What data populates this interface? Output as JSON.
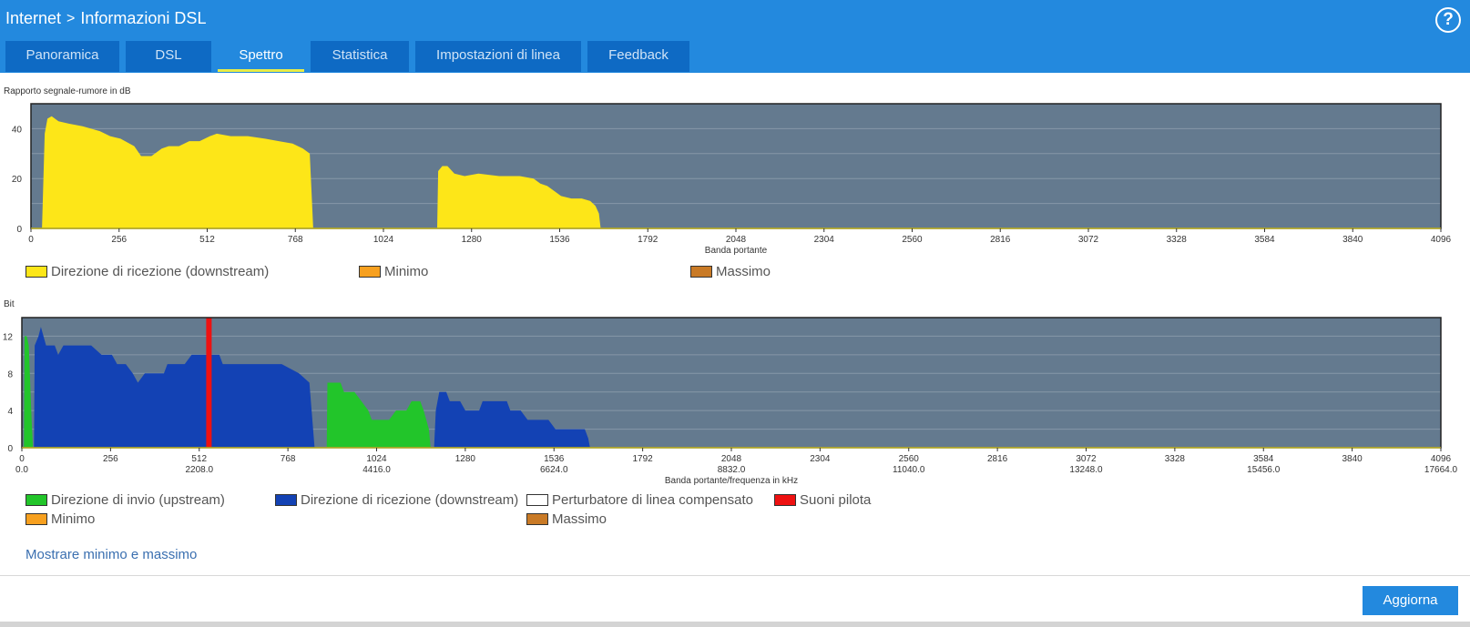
{
  "header": {
    "breadcrumb_root": "Internet",
    "breadcrumb_separator": ">",
    "breadcrumb_current": "Informazioni DSL",
    "help_label": "?"
  },
  "tabs": [
    {
      "label": "Panoramica",
      "active": false
    },
    {
      "label": "DSL",
      "active": false
    },
    {
      "label": "Spettro",
      "active": true
    },
    {
      "label": "Statistica",
      "active": false
    },
    {
      "label": "Impostazioni di linea",
      "active": false
    },
    {
      "label": "Feedback",
      "active": false
    }
  ],
  "colors": {
    "header_bg": "#2389de",
    "tab_bg": "#0e6ac4",
    "chart_bg": "#647a8f",
    "snr_downstream": "#fde618",
    "upstream": "#22c52a",
    "downstream": "#1342b4",
    "pilot": "#ee1111",
    "minimum": "#f7a01f",
    "maximum": "#c97a26"
  },
  "chart_data": [
    {
      "type": "area",
      "title": "Rapporto segnale-rumore in dB",
      "xlabel": "Banda portante",
      "xlim": [
        0,
        4096
      ],
      "ylim": [
        0,
        50
      ],
      "x_ticks": [
        0,
        256,
        512,
        768,
        1024,
        1280,
        1536,
        1792,
        2048,
        2304,
        2560,
        2816,
        3072,
        3328,
        3584,
        3840,
        4096
      ],
      "y_ticks": [
        0,
        20,
        40
      ],
      "grid": true,
      "legend": [
        {
          "label": "Direzione di ricezione (downstream)",
          "color": "#fde618"
        },
        {
          "label": "Minimo",
          "color": "#f7a01f"
        },
        {
          "label": "Massimo",
          "color": "#c97a26"
        }
      ],
      "series": [
        {
          "name": "Direzione di ricezione (downstream)",
          "color": "#fde618",
          "segments": [
            [
              [
                32,
                0
              ],
              [
                40,
                38
              ],
              [
                48,
                44
              ],
              [
                60,
                45
              ],
              [
                80,
                43
              ],
              [
                110,
                42
              ],
              [
                150,
                41
              ],
              [
                200,
                39
              ],
              [
                230,
                37
              ],
              [
                260,
                36
              ],
              [
                300,
                33
              ],
              [
                320,
                29
              ],
              [
                350,
                29
              ],
              [
                380,
                32
              ],
              [
                400,
                33
              ],
              [
                430,
                33
              ],
              [
                460,
                35
              ],
              [
                490,
                35
              ],
              [
                520,
                37
              ],
              [
                540,
                38
              ],
              [
                580,
                37
              ],
              [
                630,
                37
              ],
              [
                680,
                36
              ],
              [
                720,
                35
              ],
              [
                760,
                34
              ],
              [
                790,
                32
              ],
              [
                810,
                30
              ],
              [
                820,
                0
              ]
            ],
            [
              [
                1180,
                0
              ],
              [
                1183,
                23
              ],
              [
                1195,
                25
              ],
              [
                1210,
                25
              ],
              [
                1230,
                22
              ],
              [
                1260,
                21
              ],
              [
                1300,
                22
              ],
              [
                1360,
                21
              ],
              [
                1420,
                21
              ],
              [
                1460,
                20
              ],
              [
                1480,
                18
              ],
              [
                1500,
                17
              ],
              [
                1520,
                15
              ],
              [
                1540,
                13
              ],
              [
                1570,
                12
              ],
              [
                1600,
                12
              ],
              [
                1625,
                11
              ],
              [
                1640,
                9
              ],
              [
                1650,
                6
              ],
              [
                1655,
                0
              ]
            ]
          ]
        }
      ]
    },
    {
      "type": "area",
      "title": "Bit",
      "xlabel": "Banda portante/frequenza in kHz",
      "xlim": [
        0,
        4096
      ],
      "ylim": [
        0,
        14
      ],
      "x_ticks": [
        0,
        256,
        512,
        768,
        1024,
        1280,
        1536,
        1792,
        2048,
        2304,
        2560,
        2816,
        3072,
        3328,
        3584,
        3840,
        4096
      ],
      "x_freq_ticks": [
        {
          "at": 0,
          "label": "0.0"
        },
        {
          "at": 512,
          "label": "2208.0"
        },
        {
          "at": 1024,
          "label": "4416.0"
        },
        {
          "at": 1536,
          "label": "6624.0"
        },
        {
          "at": 2048,
          "label": "8832.0"
        },
        {
          "at": 2560,
          "label": "11040.0"
        },
        {
          "at": 3072,
          "label": "13248.0"
        },
        {
          "at": 3584,
          "label": "15456.0"
        },
        {
          "at": 4096,
          "label": "17664.0"
        }
      ],
      "y_ticks": [
        0,
        4,
        8,
        12
      ],
      "grid": true,
      "legend": [
        {
          "label": "Direzione di invio (upstream)",
          "color": "#22c52a"
        },
        {
          "label": "Direzione di ricezione (downstream)",
          "color": "#1342b4"
        },
        {
          "label": "Perturbatore di linea compensato",
          "color": "#ffffff"
        },
        {
          "label": "Suoni pilota",
          "color": "#ee1111"
        },
        {
          "label": "Minimo",
          "color": "#f7a01f"
        },
        {
          "label": "Massimo",
          "color": "#c97a26"
        }
      ],
      "series": [
        {
          "name": "Direzione di invio (upstream)",
          "color": "#22c52a",
          "segments": [
            [
              [
                6,
                0
              ],
              [
                8,
                12
              ],
              [
                14,
                12
              ],
              [
                20,
                11
              ],
              [
                28,
                3
              ],
              [
                32,
                0
              ]
            ],
            [
              [
                880,
                0
              ],
              [
                882,
                7
              ],
              [
                920,
                7
              ],
              [
                930,
                6
              ],
              [
                960,
                6
              ],
              [
                980,
                5
              ],
              [
                1000,
                4
              ],
              [
                1010,
                3
              ],
              [
                1030,
                3
              ],
              [
                1060,
                3
              ],
              [
                1080,
                4
              ],
              [
                1110,
                4
              ],
              [
                1125,
                5
              ],
              [
                1150,
                5
              ],
              [
                1160,
                4
              ],
              [
                1175,
                2
              ],
              [
                1180,
                0
              ]
            ]
          ]
        },
        {
          "name": "Direzione di ricezione (downstream)",
          "color": "#1342b4",
          "segments": [
            [
              [
                35,
                0
              ],
              [
                37,
                11
              ],
              [
                48,
                12
              ],
              [
                55,
                13
              ],
              [
                70,
                11
              ],
              [
                95,
                11
              ],
              [
                105,
                10
              ],
              [
                120,
                11
              ],
              [
                200,
                11
              ],
              [
                230,
                10
              ],
              [
                260,
                10
              ],
              [
                275,
                9
              ],
              [
                300,
                9
              ],
              [
                320,
                8
              ],
              [
                335,
                7
              ],
              [
                355,
                8
              ],
              [
                410,
                8
              ],
              [
                420,
                9
              ],
              [
                470,
                9
              ],
              [
                490,
                10
              ],
              [
                570,
                10
              ],
              [
                580,
                9
              ],
              [
                640,
                9
              ],
              [
                750,
                9
              ],
              [
                800,
                8
              ],
              [
                830,
                7
              ],
              [
                845,
                0
              ]
            ],
            [
              [
                1190,
                0
              ],
              [
                1195,
                4
              ],
              [
                1205,
                6
              ],
              [
                1225,
                6
              ],
              [
                1235,
                5
              ],
              [
                1265,
                5
              ],
              [
                1280,
                4
              ],
              [
                1320,
                4
              ],
              [
                1330,
                5
              ],
              [
                1400,
                5
              ],
              [
                1410,
                4
              ],
              [
                1440,
                4
              ],
              [
                1460,
                3
              ],
              [
                1520,
                3
              ],
              [
                1540,
                2
              ],
              [
                1625,
                2
              ],
              [
                1635,
                1
              ],
              [
                1640,
                0
              ]
            ]
          ]
        }
      ],
      "pilot_tone_x": 540
    }
  ],
  "links": {
    "show_min_max": "Mostrare minimo e massimo"
  },
  "buttons": {
    "refresh": "Aggiorna"
  }
}
